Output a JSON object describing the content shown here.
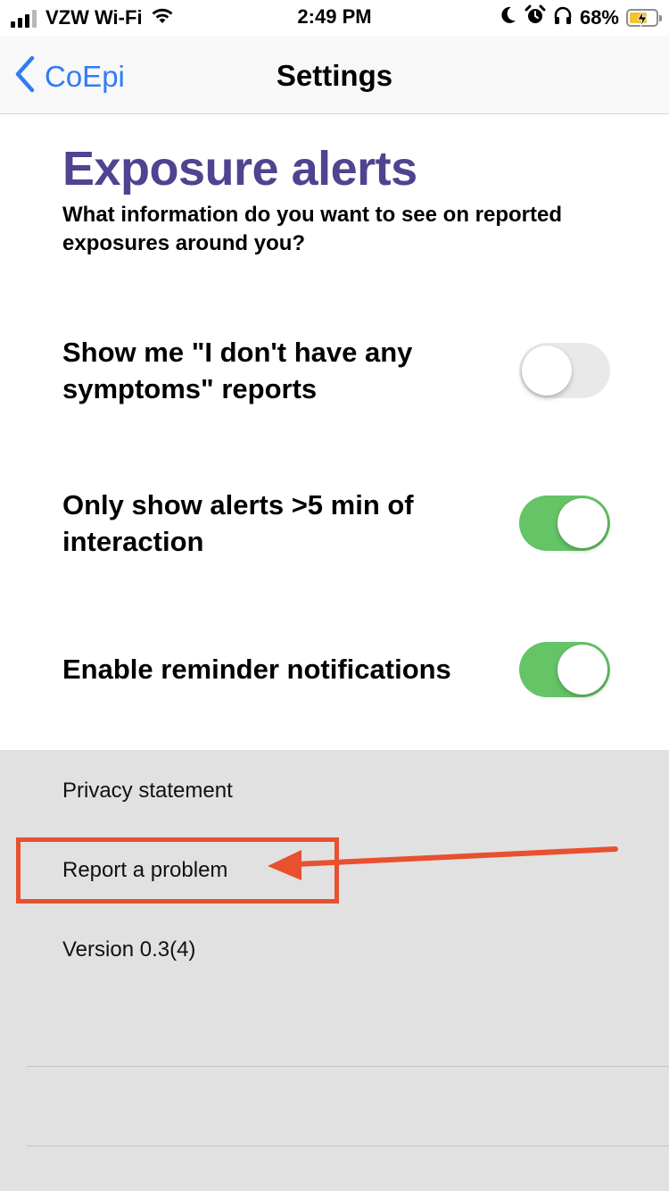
{
  "status_bar": {
    "carrier": "VZW Wi-Fi",
    "time": "2:49 PM",
    "battery_percent": "68%",
    "icons": [
      "signal-icon",
      "wifi-icon",
      "moon-icon",
      "alarm-icon",
      "headphones-icon",
      "battery-charging-icon"
    ]
  },
  "nav": {
    "back_label": "CoEpi",
    "title": "Settings"
  },
  "section": {
    "title": "Exposure alerts",
    "subtitle": "What information do you want to see on reported exposures around you?"
  },
  "settings": [
    {
      "label": "Show me \"I don't have any symptoms\" reports",
      "enabled": false
    },
    {
      "label": "Only show alerts >5 min of interaction",
      "enabled": true
    },
    {
      "label": "Enable reminder notifications",
      "enabled": true
    }
  ],
  "footer": {
    "privacy_label": "Privacy statement",
    "report_label": "Report a problem",
    "version": "Version 0.3(4)"
  },
  "annotation": {
    "highlight_target": "Report a problem",
    "color": "#e8502f"
  },
  "colors": {
    "accent": "#2f7cf6",
    "title": "#4e4490",
    "toggle_on": "#65c466",
    "toggle_off": "#e9e9ea"
  }
}
